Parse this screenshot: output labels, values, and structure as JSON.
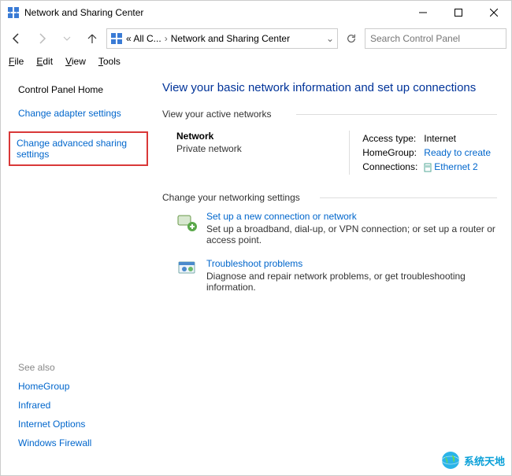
{
  "window": {
    "title": "Network and Sharing Center"
  },
  "breadcrumb": {
    "item1": "« All C...",
    "item2": "Network and Sharing Center"
  },
  "search": {
    "placeholder": "Search Control Panel"
  },
  "menubar": {
    "file": "File",
    "edit": "Edit",
    "view": "View",
    "tools": "Tools"
  },
  "sidebar": {
    "home": "Control Panel Home",
    "adapter": "Change adapter settings",
    "advanced": "Change advanced sharing settings",
    "seealso_label": "See also",
    "seealso": {
      "homegroup": "HomeGroup",
      "infrared": "Infrared",
      "internet_options": "Internet Options",
      "firewall": "Windows Firewall"
    }
  },
  "main": {
    "heading": "View your basic network information and set up connections",
    "active_label": "View your active networks",
    "change_label": "Change your networking settings",
    "network": {
      "name": "Network",
      "type": "Private network",
      "access_label": "Access type:",
      "access_value": "Internet",
      "homegroup_label": "HomeGroup:",
      "homegroup_value": "Ready to create",
      "connections_label": "Connections:",
      "connections_value": "Ethernet 2"
    },
    "setup": {
      "title": "Set up a new connection or network",
      "desc": "Set up a broadband, dial-up, or VPN connection; or set up a router or access point."
    },
    "troubleshoot": {
      "title": "Troubleshoot problems",
      "desc": "Diagnose and repair network problems, or get troubleshooting information."
    }
  },
  "watermark": "系统天地"
}
